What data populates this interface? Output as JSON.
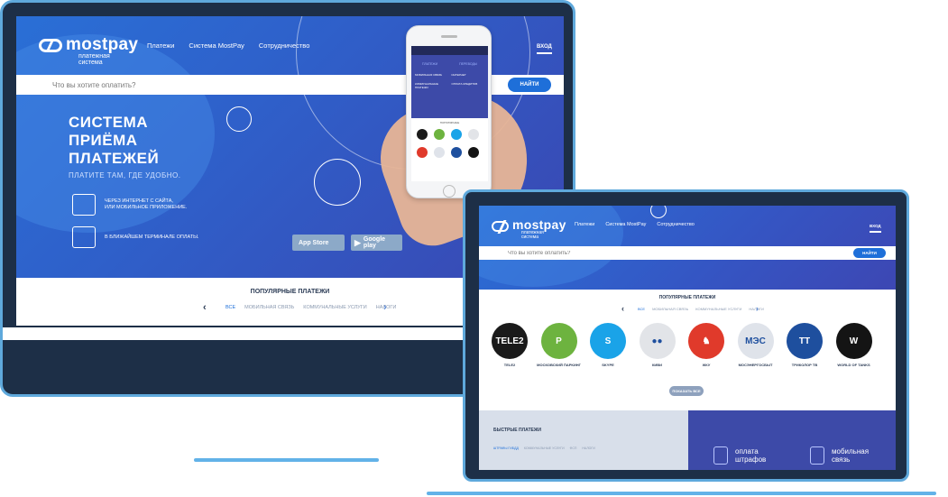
{
  "brand": {
    "name": "mostpay",
    "tagline_line1": "платежная",
    "tagline_line2": "система"
  },
  "nav": {
    "items": [
      "Платежи",
      "Система MostPay",
      "Сотрудничество"
    ],
    "login": "ВХОД"
  },
  "search": {
    "placeholder": "Что вы хотите оплатить?",
    "button": "НАЙТИ"
  },
  "hero": {
    "title_lines": [
      "СИСТЕМА",
      "ПРИЁМА",
      "ПЛАТЕЖЕЙ"
    ],
    "subtitle": "ПЛАТИТЕ ТАМ, ГДЕ УДОБНО.",
    "feature_online_line1": "ЧЕРЕЗ ИНТЕРНЕТ С САЙТА,",
    "feature_online_line2": "ИЛИ МОБИЛЬНОЕ ПРИЛОЖЕНИЕ.",
    "feature_terminal": "В БЛИЖАЙШЕМ ТЕРМИНАЛЕ ОПЛАТЫ."
  },
  "stores": {
    "appstore_small": "Доступно в",
    "appstore": "App Store",
    "google_small": "Доступно в",
    "google": "Google play"
  },
  "popular": {
    "title": "ПОПУЛЯРНЫЕ ПЛАТЕЖИ",
    "tabs": [
      "ВСЕ",
      "МОБИЛЬНАЯ СВЯЗЬ",
      "КОММУНАЛЬНЫЕ УСЛУГИ",
      "НАЛОГИ"
    ],
    "show_all": "ПОКАЗАТЬ ВСЕ"
  },
  "providers": [
    {
      "label": "TELE2",
      "caption": "TELE2",
      "color": "#1a1a1a"
    },
    {
      "label": "P",
      "caption": "МОСКОВСКИЙ ПАРКИНГ",
      "color": "#6db33f"
    },
    {
      "label": "S",
      "caption": "SKYPE",
      "color": "#1aa3e8"
    },
    {
      "label": "●●",
      "caption": "КИВИ",
      "color": "#e2e4e8"
    },
    {
      "label": "♞",
      "caption": "ЖКУ",
      "color": "#e03a2b"
    },
    {
      "label": "МЭС",
      "caption": "МОСЭНЕРГОСБЫТ",
      "color": "#dfe3ea"
    },
    {
      "label": "ТТ",
      "caption": "ТРИКОЛОР ТВ",
      "color": "#1e4f9e"
    },
    {
      "label": "W",
      "caption": "WORLD OF TANKS",
      "color": "#141414"
    }
  ],
  "fast": {
    "title": "БЫСТРЫЕ ПЛАТЕЖИ",
    "tabs": [
      "ШТРАФЫ ГИБДД",
      "КОММУНАЛЬНЫЕ УСЛУГИ",
      "ФСП",
      "НАЛОГИ"
    ]
  },
  "promos": {
    "fines_line1": "оплата",
    "fines_line2": "штрафов",
    "mobile_line1": "мобильная",
    "mobile_line2": "связь"
  },
  "phone": {
    "tab1": "ПЛАТЕЖИ",
    "tab2": "ПЕРЕВОДЫ",
    "menu": [
      "МОБИЛЬНАЯ СВЯЗЬ",
      "ИНТЕРНЕТ",
      "КОММУНАЛЬНЫЕ ПЛАТЕЖИ",
      "ОПЛАТА КРЕДИТОВ"
    ],
    "popular": "ПОПУЛЯРНЫЕ"
  },
  "colors": {
    "accent": "#1e6fd9",
    "hero_start": "#2a6fd6",
    "hero_end": "#3d47b3",
    "frame": "#1d2f47",
    "frame_border": "#5fa9dc"
  }
}
